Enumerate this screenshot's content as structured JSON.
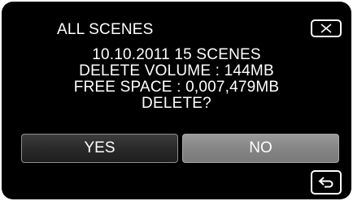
{
  "dialog": {
    "title": "ALL SCENES",
    "message": {
      "line1": "10.10.2011 15 SCENES",
      "line2": "DELETE VOLUME : 144MB",
      "line3": "FREE SPACE : 0,007,479MB",
      "line4": "DELETE?"
    },
    "yes_label": "YES",
    "no_label": "NO",
    "icons": {
      "close": "close-icon",
      "back": "return-arrow-icon"
    }
  },
  "colors": {
    "background": "#000000",
    "text": "#ffffff",
    "yes_button": "#2a2a2a",
    "no_button_selected": "#858585"
  }
}
